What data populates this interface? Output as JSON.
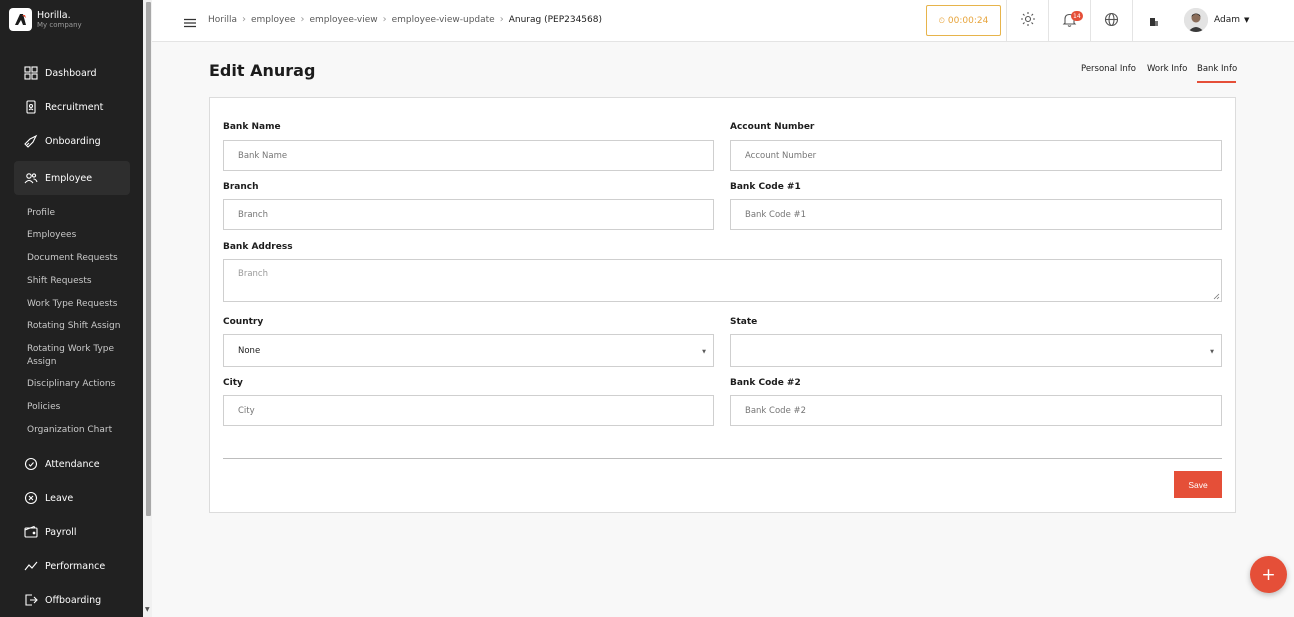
{
  "brand": {
    "name": "Horilla.",
    "company": "My company"
  },
  "sidebar": {
    "items": [
      {
        "label": "Dashboard",
        "icon": "dashboard-icon"
      },
      {
        "label": "Recruitment",
        "icon": "recruitment-icon"
      },
      {
        "label": "Onboarding",
        "icon": "rocket-icon"
      },
      {
        "label": "Employee",
        "icon": "users-icon"
      },
      {
        "label": "Attendance",
        "icon": "attendance-icon"
      },
      {
        "label": "Leave",
        "icon": "leave-icon"
      },
      {
        "label": "Payroll",
        "icon": "wallet-icon"
      },
      {
        "label": "Performance",
        "icon": "chart-line-icon"
      },
      {
        "label": "Offboarding",
        "icon": "logout-icon"
      }
    ],
    "employee_sub": [
      "Profile",
      "Employees",
      "Document Requests",
      "Shift Requests",
      "Work Type Requests",
      "Rotating Shift Assign",
      "Rotating Work Type Assign",
      "Disciplinary Actions",
      "Policies",
      "Organization Chart"
    ]
  },
  "topbar": {
    "breadcrumbs": [
      "Horilla",
      "employee",
      "employee-view",
      "employee-view-update",
      "Anurag (PEP234568)"
    ],
    "timer": "00:00:24",
    "notifications": "14",
    "user": "Adam"
  },
  "page": {
    "title": "Edit Anurag",
    "tabs": [
      "Personal Info",
      "Work Info",
      "Bank Info"
    ],
    "active_tab": "Bank Info"
  },
  "form": {
    "bank_name": {
      "label": "Bank Name",
      "placeholder": "Bank Name"
    },
    "account_number": {
      "label": "Account Number",
      "placeholder": "Account Number"
    },
    "branch": {
      "label": "Branch",
      "placeholder": "Branch"
    },
    "bank_code_1": {
      "label": "Bank Code #1",
      "placeholder": "Bank Code #1"
    },
    "bank_address": {
      "label": "Bank Address",
      "placeholder": "Branch"
    },
    "country": {
      "label": "Country",
      "value": "None"
    },
    "state": {
      "label": "State",
      "value": ""
    },
    "city": {
      "label": "City",
      "placeholder": "City"
    },
    "bank_code_2": {
      "label": "Bank Code #2",
      "placeholder": "Bank Code #2"
    },
    "save_label": "Save"
  },
  "fab_label": "+",
  "colors": {
    "accent": "#e54f38",
    "sidebar": "#212121",
    "timer": "#e7a43b"
  }
}
